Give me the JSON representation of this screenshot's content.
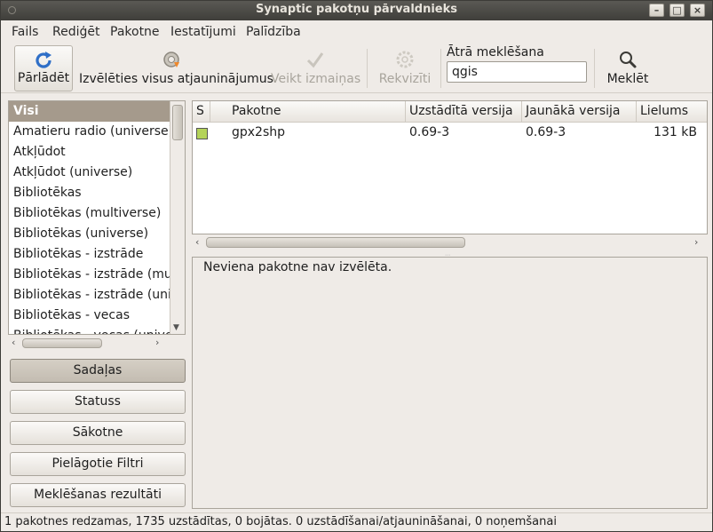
{
  "window": {
    "title": "Synaptic pakotņu pārvaldnieks"
  },
  "menubar": [
    "Fails",
    "Rediģēt",
    "Pakotne",
    "Iestatījumi",
    "Palīdzība"
  ],
  "toolbar": {
    "reload": "Pārlādēt",
    "mark_all": "Izvēlēties visus atjauninājumus",
    "apply": "Veikt izmaiņas",
    "properties": "Rekvizīti",
    "search_label": "Ātrā meklēšana",
    "search_value": "qgis",
    "search_button": "Meklēt"
  },
  "sidebar": {
    "categories": [
      "Visi",
      "Amatieru radio (universe)",
      "Atkļūdot",
      "Atkļūdot (universe)",
      "Bibliotēkas",
      "Bibliotēkas (multiverse)",
      "Bibliotēkas (universe)",
      "Bibliotēkas - izstrāde",
      "Bibliotēkas - izstrāde (multiverse)",
      "Bibliotēkas - izstrāde (universe)",
      "Bibliotēkas - vecas",
      "Bibliotēkas - vecas (universe)"
    ],
    "filters": [
      "Sadaļas",
      "Statuss",
      "Sākotne",
      "Pielāgotie Filtri",
      "Meklēšanas rezultāti"
    ]
  },
  "packages": {
    "columns": [
      "S",
      "Pakotne",
      "Uzstādītā versija",
      "Jaunākā versija",
      "Lielums"
    ],
    "rows": [
      {
        "name": "gpx2shp",
        "installed": "0.69-3",
        "latest": "0.69-3",
        "size": "131 kB"
      }
    ]
  },
  "details": {
    "text": "Neviena pakotne nav izvēlēta."
  },
  "statusbar": {
    "text": "1 pakotnes redzamas, 1735 uzstādītas, 0 bojātas. 0 uzstādīšanai/atjaunināšanai, 0 noņemšanai"
  },
  "colors": {
    "selection": "#a59a8c",
    "installed_marker": "#b4d35a",
    "titlebar": "#3f3e3a"
  }
}
